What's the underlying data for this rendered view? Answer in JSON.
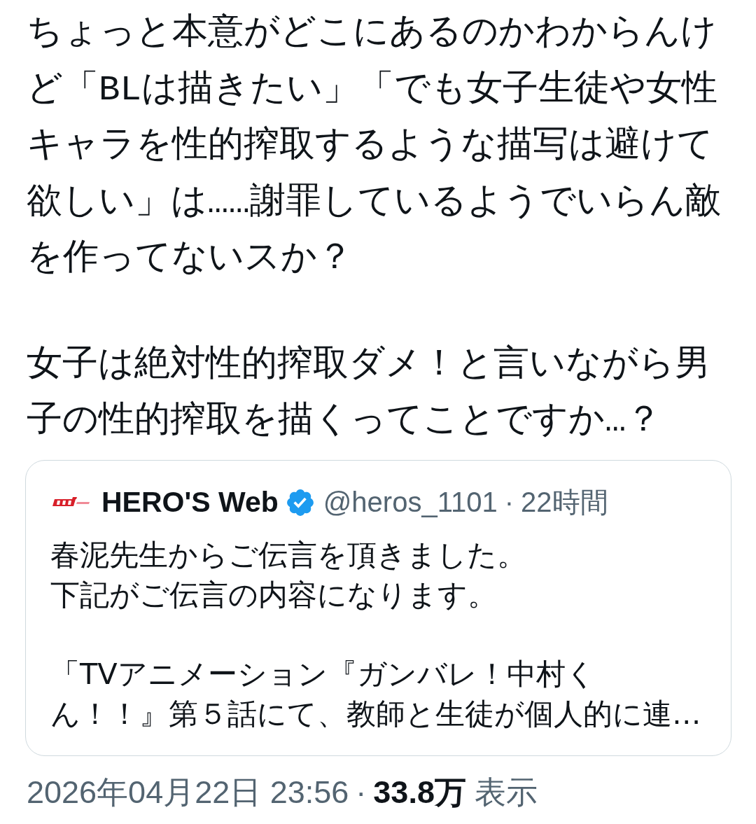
{
  "tweet": {
    "paragraphs": [
      "ちょっと本意がどこにあるのかわからんけど「BLは描きたい」「でも女子生徒や女性キャラを性的搾取するような描写は避けて欲しい」は……謝罪しているようでいらん敵を作ってないスか？",
      "女子は絶対性的搾取ダメ！と言いながら男子の性的搾取を描くってことですか…？"
    ]
  },
  "quoted_tweet": {
    "author_name": "HERO'S Web",
    "verified": true,
    "handle": "@heros_1101",
    "separator": "·",
    "time": "22時間",
    "paragraphs": [
      [
        "春泥先生からご伝言を頂きました。",
        "下記がご伝言の内容になります。"
      ],
      [
        "「TVアニメーション『ガンバレ！中村くん！！』第５話にて、教師と生徒が個人的に連…"
      ]
    ]
  },
  "meta": {
    "timestamp": "2026年04月22日 23:56",
    "separator": "·",
    "views_count": "33.8万",
    "views_label": "表示"
  }
}
